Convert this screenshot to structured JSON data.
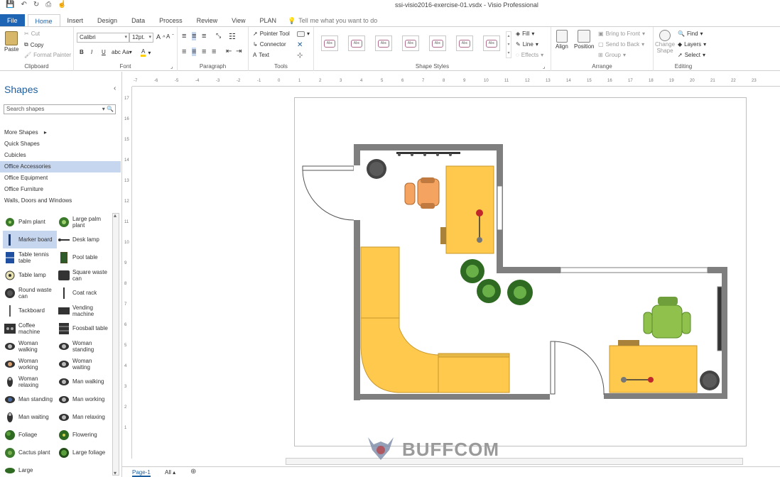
{
  "window": {
    "title": "ssi-visio2016-exercise-01.vsdx  -  Visio Professional"
  },
  "tabs": [
    {
      "label": "File"
    },
    {
      "label": "Home"
    },
    {
      "label": "Insert"
    },
    {
      "label": "Design"
    },
    {
      "label": "Data"
    },
    {
      "label": "Process"
    },
    {
      "label": "Review"
    },
    {
      "label": "View"
    },
    {
      "label": "PLAN"
    }
  ],
  "tell_me": "Tell me what you want to do",
  "ribbon": {
    "clipboard": {
      "label": "Clipboard",
      "paste": "Paste",
      "cut": "Cut",
      "copy": "Copy",
      "format_painter": "Format Painter"
    },
    "font": {
      "label": "Font",
      "family": "Calibri",
      "size": "12pt."
    },
    "paragraph": {
      "label": "Paragraph"
    },
    "tools": {
      "label": "Tools",
      "pointer": "Pointer Tool",
      "connector": "Connector",
      "text": "Text"
    },
    "shape_styles": {
      "label": "Shape Styles",
      "sample": "Abc",
      "fill": "Fill",
      "line": "Line",
      "effects": "Effects"
    },
    "arrange": {
      "label": "Arrange",
      "align": "Align",
      "position": "Position",
      "bring_front": "Bring to Front",
      "send_back": "Send to Back",
      "group": "Group"
    },
    "editing": {
      "label": "Editing",
      "change_shape_1": "Change",
      "change_shape_2": "Shape",
      "find": "Find",
      "layers": "Layers",
      "select": "Select"
    }
  },
  "shapes_pane": {
    "title": "Shapes",
    "search_placeholder": "Search shapes",
    "stencils": [
      {
        "label": "More Shapes"
      },
      {
        "label": "Quick Shapes"
      },
      {
        "label": "Cubicles"
      },
      {
        "label": "Office Accessories"
      },
      {
        "label": "Office Equipment"
      },
      {
        "label": "Office Furniture"
      },
      {
        "label": "Walls, Doors and Windows"
      }
    ],
    "shapes": [
      {
        "label": "Palm plant"
      },
      {
        "label": "Large palm plant"
      },
      {
        "label": "Marker board"
      },
      {
        "label": "Desk lamp"
      },
      {
        "label": "Table tennis table"
      },
      {
        "label": "Pool table"
      },
      {
        "label": "Table lamp"
      },
      {
        "label": "Square waste can"
      },
      {
        "label": "Round waste can"
      },
      {
        "label": "Coat rack"
      },
      {
        "label": "Tackboard"
      },
      {
        "label": "Vending machine"
      },
      {
        "label": "Coffee machine"
      },
      {
        "label": "Foosball table"
      },
      {
        "label": "Woman walking"
      },
      {
        "label": "Woman standing"
      },
      {
        "label": "Woman working"
      },
      {
        "label": "Woman waiting"
      },
      {
        "label": "Woman relaxing"
      },
      {
        "label": "Man walking"
      },
      {
        "label": "Man standing"
      },
      {
        "label": "Man working"
      },
      {
        "label": "Man waiting"
      },
      {
        "label": "Man relaxing"
      },
      {
        "label": "Foliage"
      },
      {
        "label": "Flowering"
      },
      {
        "label": "Cactus plant"
      },
      {
        "label": "Large foliage"
      },
      {
        "label": "Large"
      }
    ]
  },
  "ruler": {
    "h_ticks": [
      "-7",
      "-6",
      "-5",
      "-4",
      "-3",
      "-2",
      "-1",
      "0",
      "1",
      "2",
      "3",
      "4",
      "5",
      "6",
      "7",
      "8",
      "9",
      "10",
      "11",
      "12",
      "13",
      "14",
      "15",
      "16",
      "17",
      "18",
      "19",
      "20",
      "21",
      "22",
      "23"
    ],
    "v_ticks": [
      "17",
      "16",
      "15",
      "14",
      "13",
      "12",
      "11",
      "10",
      "9",
      "8",
      "7",
      "6",
      "5",
      "4",
      "3",
      "2",
      "1"
    ]
  },
  "status": {
    "page_tab": "Page-1",
    "all_tab": "All",
    "add_page": "⊕"
  },
  "watermark": "BUFFCOM",
  "colors": {
    "accent": "#1e5fa0",
    "file_tab": "#1e64b4",
    "desk": "#ffc94d",
    "wall": "#7f7f7f",
    "chair_orange": "#f4a460",
    "chair_green": "#8fc14c",
    "selected": "#c7d6ef"
  }
}
